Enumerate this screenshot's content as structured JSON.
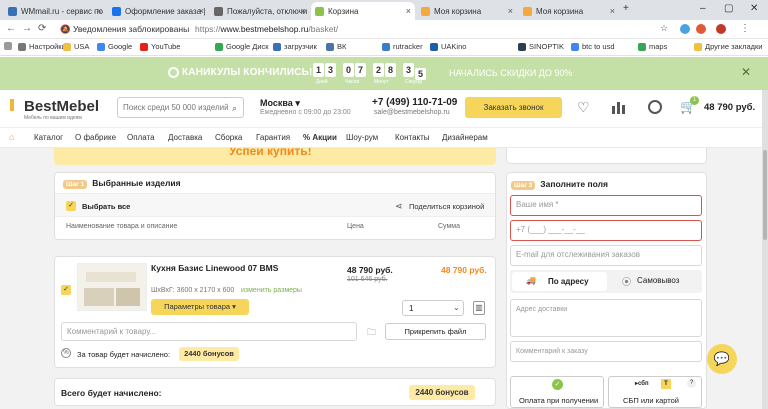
{
  "browser": {
    "tabs": [
      {
        "title": "WMmail.ru - сервис по",
        "color": "#3b6fb6"
      },
      {
        "title": "Оформление заказа | с",
        "color": "#1a73e8"
      },
      {
        "title": "Пожалуйста, отключи",
        "color": "#666666"
      },
      {
        "title": "Корзина",
        "color": "#8cc34a"
      },
      {
        "title": "Моя корзина",
        "color": "#f5a742"
      },
      {
        "title": "Моя корзина",
        "color": "#f5a742"
      }
    ],
    "blocked_notice": "Уведомления заблокированы",
    "url_prefix": "https://",
    "url_domain": "www.bestmebelshop.ru",
    "url_path": "/basket/"
  },
  "bookmarks": [
    "Настройки",
    "USA",
    "Google",
    "YouTube",
    "Google Диск",
    "загрузчик",
    "ВК",
    "rutracker",
    "UAKino",
    "SINOPTIK",
    "btc to usd",
    "maps",
    "Другие закладки"
  ],
  "promo": {
    "title": "КАНИКУЛЫ КОНЧИЛИСЬ!",
    "digits": [
      "1",
      "3",
      "0",
      "7",
      "2",
      "8",
      "3",
      "5"
    ],
    "labels": [
      "Дней",
      "Часов",
      "Минут",
      "Секунд"
    ],
    "subtitle": "НАЧАЛИСЬ СКИДКИ ДО 90%"
  },
  "header": {
    "logo": "BestMebel",
    "logo_sub": "Мебель по вашим идеям",
    "search_placeholder": "Поиск среди 50 000 изделий",
    "city": "Москва",
    "hours": "Ежедневно с 09:00 до 23:00",
    "phone": "+7 (499) 110-71-09",
    "email": "sale@bestmebelshop.ru",
    "call_button": "Заказать звонок",
    "cart_count": "1",
    "cart_total": "48 790 руб."
  },
  "menu": [
    "Каталог",
    "О фабрике",
    "Оплата",
    "Доставка",
    "Сборка",
    "Гарантия",
    "% Акции",
    "Шоу-рум",
    "Контакты",
    "Дизайнерам"
  ],
  "notice": "Успей купить!",
  "cart": {
    "step_label": "Шаг 1",
    "title": "Выбранные изделия",
    "select_all": "Выбрать все",
    "share": "Поделиться корзиной",
    "col_name": "Наименование товара и описание",
    "col_price": "Цена",
    "col_sum": "Сумма",
    "item": {
      "name": "Кухня Базис Linewood 07 BMS",
      "size_label": "ШхВхГ: 3600 х 2170 х 600",
      "change_size": "изменить размеры",
      "params_button": "Параметры товара",
      "price": "48 790 руб.",
      "old_price": "101 646 руб.",
      "sum": "48 790 руб.",
      "qty": "1",
      "comment_placeholder": "Комментарий к товару...",
      "attach_button": "Прикрепить файл",
      "bonus_text": "За товар будет начислено:",
      "bonus": "2440 бонусов"
    },
    "total_bonus_label": "Всего будет начислено:",
    "total_bonus": "2440 бонусов"
  },
  "form": {
    "step_label": "Шаг 3",
    "title": "Заполните поля",
    "name_placeholder": "Ваше имя *",
    "phone_placeholder": "+7 (___) ___-__-__",
    "email_placeholder": "E-mail для отслеживания заказов",
    "tab_address": "По адресу",
    "tab_pickup": "Самовывоз",
    "address_placeholder": "Адрес доставки",
    "comment_placeholder": "Комментарий к заказу",
    "pay_on_receipt": "Оплата при получении",
    "pay_sbp": "СБП или картой"
  }
}
